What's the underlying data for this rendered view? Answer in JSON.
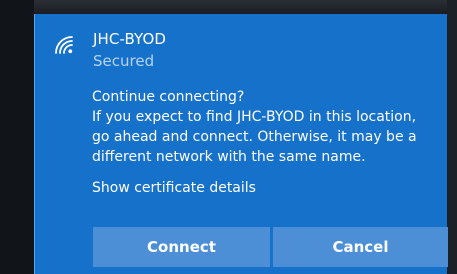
{
  "network": {
    "name": "JHC-BYOD",
    "status": "Secured",
    "icon": "wifi-signal-icon"
  },
  "prompt": {
    "line1": "Continue connecting?",
    "line2": "If you expect to find JHC-BYOD in this location,",
    "line3": "go ahead and connect. Otherwise, it may be a",
    "line4": "different network with the same name.",
    "cert_link": "Show certificate details"
  },
  "buttons": {
    "connect": "Connect",
    "cancel": "Cancel"
  },
  "colors": {
    "panel": "#1671cb",
    "button": "#4c8fd7",
    "secondary_text": "#b6d3f2"
  }
}
